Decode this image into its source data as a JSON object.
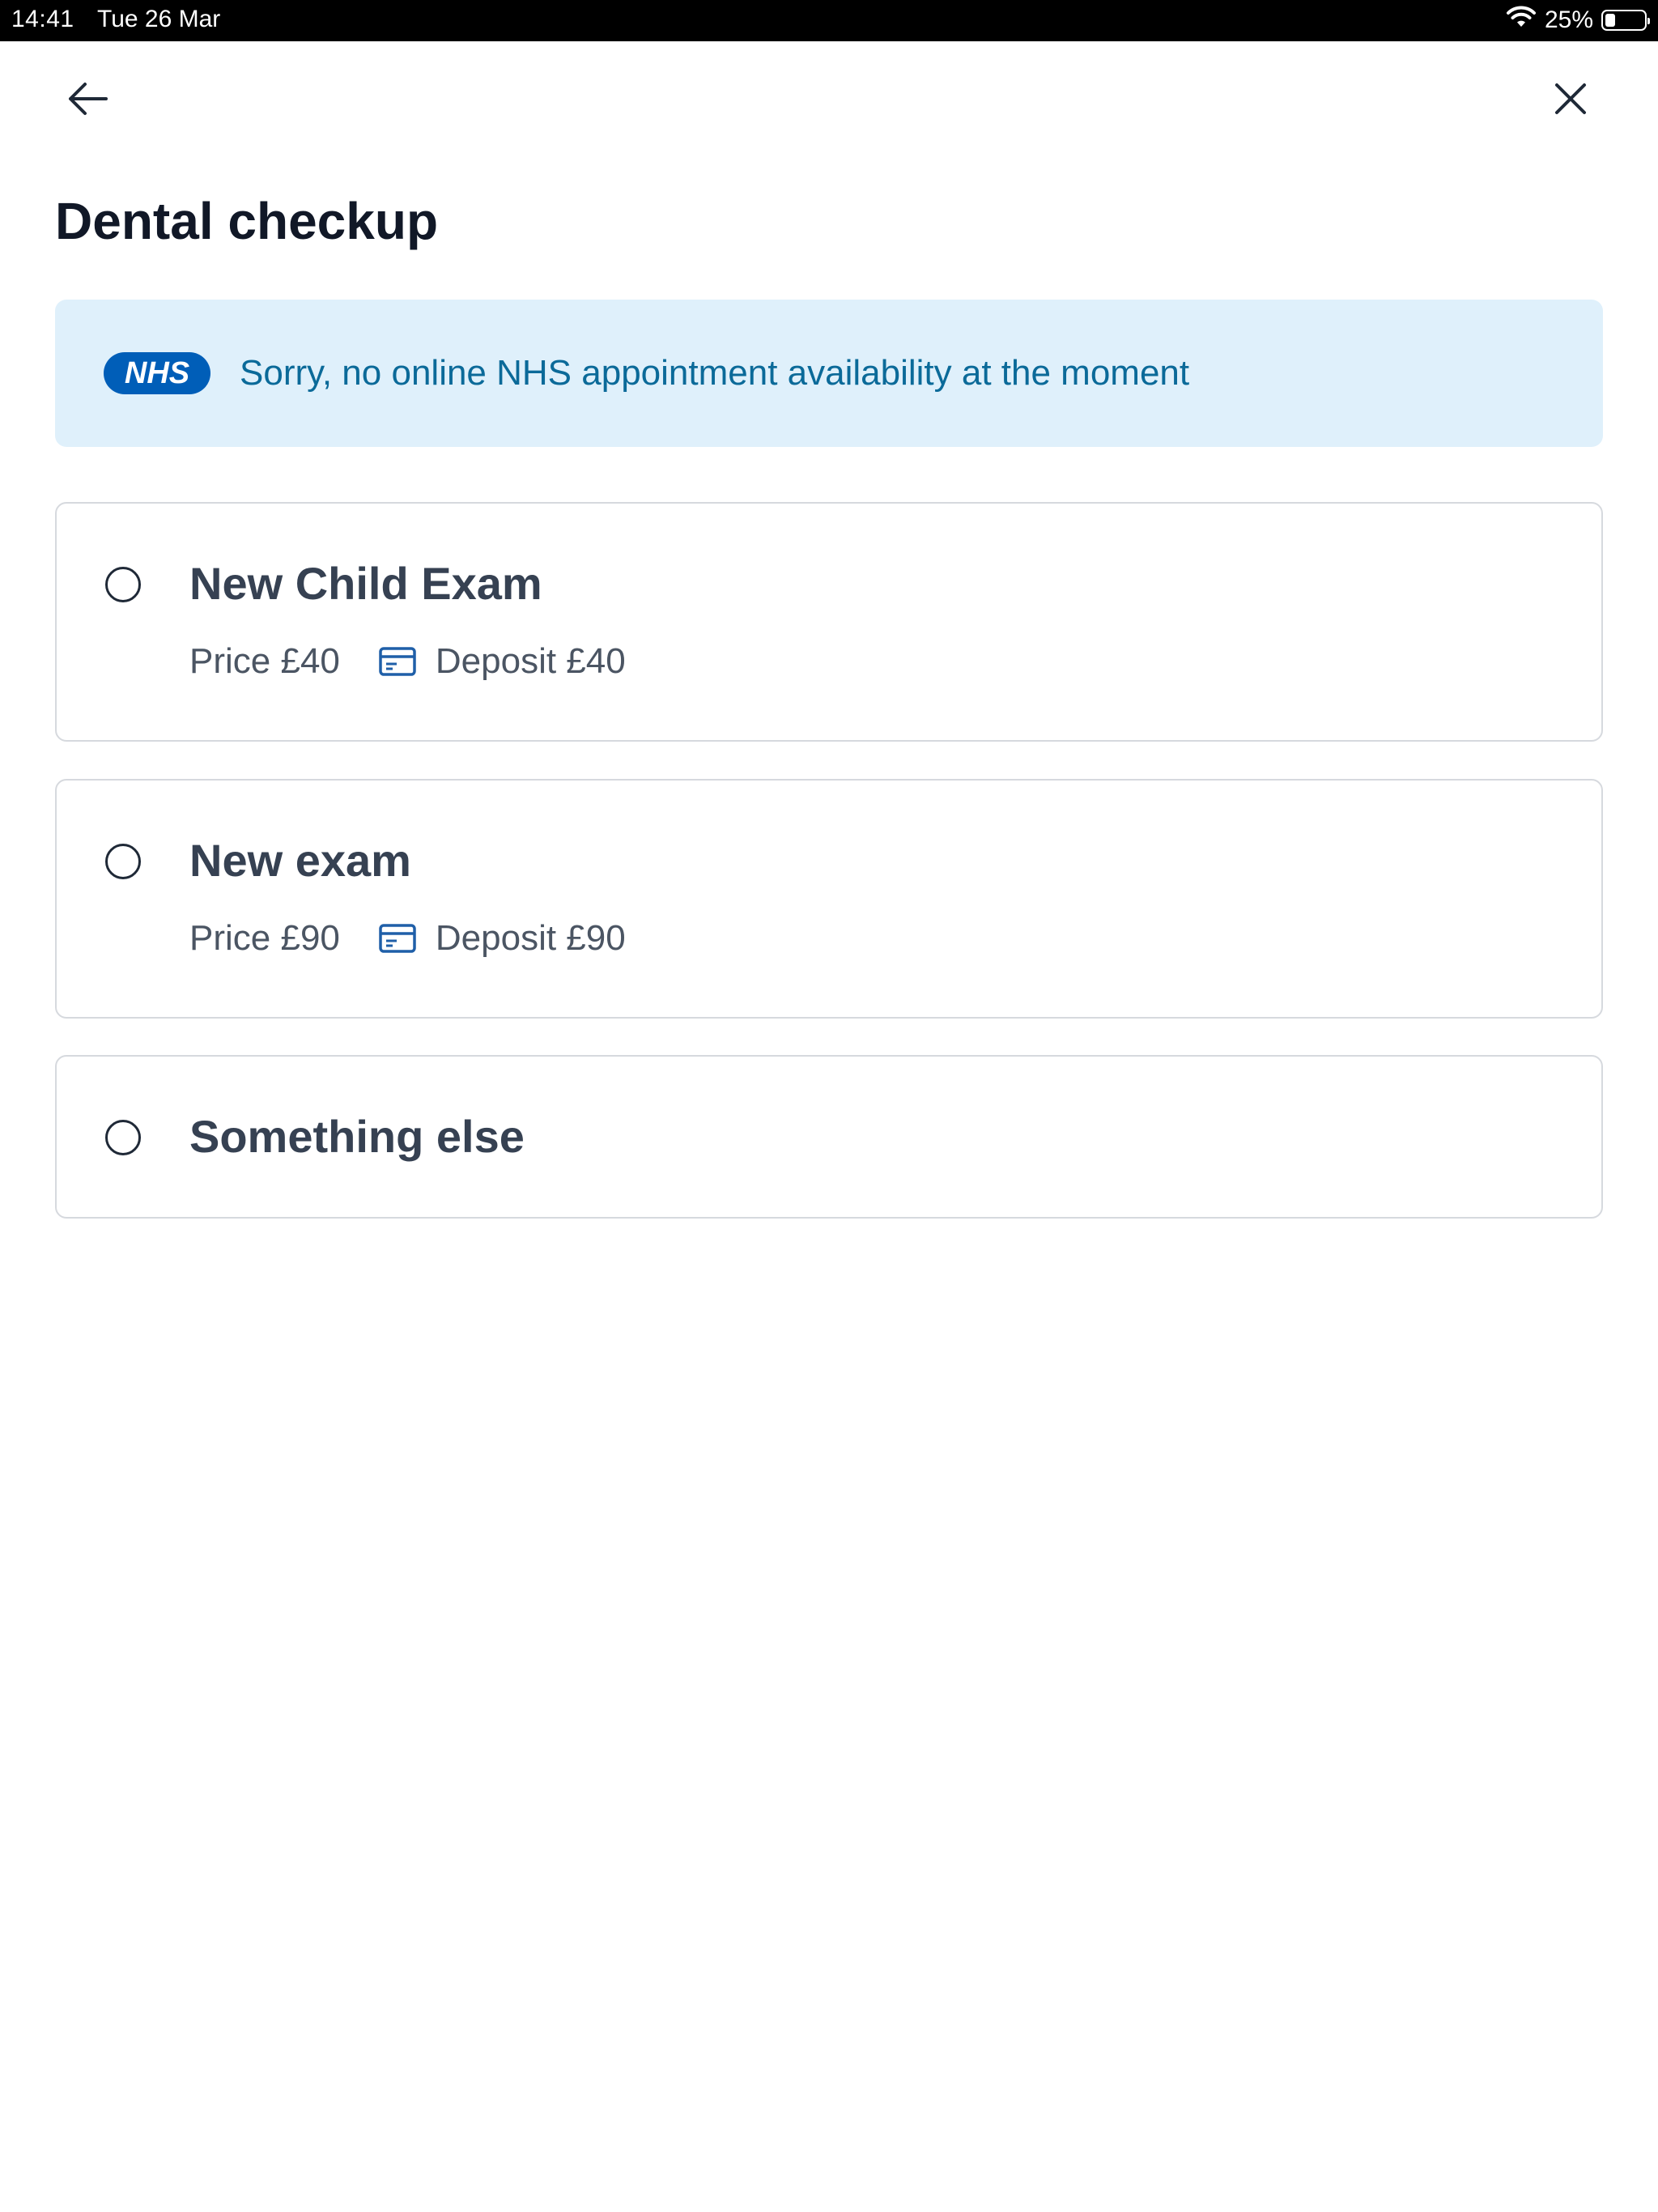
{
  "status_bar": {
    "time": "14:41",
    "date": "Tue 26 Mar",
    "battery_percent": "25%",
    "battery_level": 0.25,
    "icons": [
      "wifi-icon",
      "battery-icon"
    ]
  },
  "nav": {
    "back_icon": "arrow-left-icon",
    "close_icon": "close-icon"
  },
  "page": {
    "title": "Dental checkup"
  },
  "nhs_banner": {
    "logo_text": "NHS",
    "message": "Sorry, no online NHS appointment availability at the moment",
    "colors": {
      "background": "#dff0fb",
      "logo": "#005eb8",
      "text": "#0b6a99"
    }
  },
  "options": [
    {
      "title": "New Child Exam",
      "price": "Price £40",
      "deposit": "Deposit £40",
      "selected": false
    },
    {
      "title": "New exam",
      "price": "Price £90",
      "deposit": "Deposit £90",
      "selected": false
    },
    {
      "title": "Something else",
      "selected": false
    }
  ]
}
